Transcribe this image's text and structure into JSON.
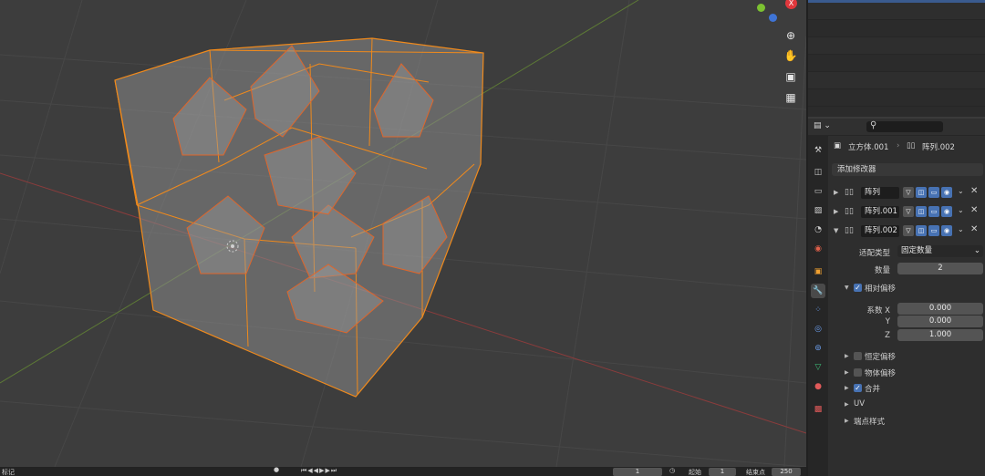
{
  "viewport": {
    "tools": [
      {
        "icon": "zoom-icon",
        "glyph": "⊕"
      },
      {
        "icon": "hand-icon",
        "glyph": "✋"
      },
      {
        "icon": "camera-icon",
        "glyph": "▣"
      },
      {
        "icon": "ortho-grid-icon",
        "glyph": "▦"
      }
    ],
    "gizmo_x_label": "X"
  },
  "properties": {
    "breadcrumb_object": "立方体.001",
    "breadcrumb_modifier": "阵列.002",
    "add_modifier_label": "添加修改器",
    "modifiers": [
      {
        "name": "阵列",
        "expanded": false
      },
      {
        "name": "阵列.001",
        "expanded": false
      },
      {
        "name": "阵列.002",
        "expanded": true
      }
    ],
    "fit_type_label": "适配类型",
    "fit_type_value": "固定数量",
    "count_label": "数量",
    "count_value": "2",
    "relative_offset_label": "相对偏移",
    "factor_x_label": "系数 X",
    "factor_x_value": "0.000",
    "factor_y_label": "Y",
    "factor_y_value": "0.000",
    "factor_z_label": "Z",
    "factor_z_value": "1.000",
    "constant_offset_label": "恒定偏移",
    "object_offset_label": "物体偏移",
    "merge_label": "合并",
    "uv_label": "UV",
    "caps_label": "端点样式"
  },
  "timeline": {
    "left_label": "标记",
    "current_frame": "1",
    "start_label": "起始",
    "start_value": "1",
    "end_label": "结束点",
    "end_value": "250"
  }
}
